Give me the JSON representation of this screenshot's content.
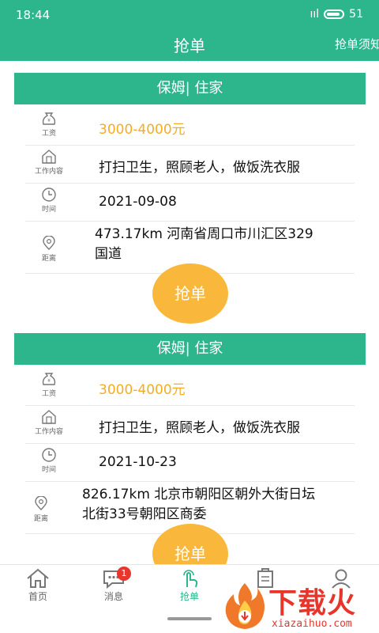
{
  "status_bar": {
    "time": "18:44",
    "signal": "ııl",
    "battery": "51"
  },
  "header": {
    "title": "抢单",
    "right_link": "抢单须知"
  },
  "orders": [
    {
      "category": "保姆| 住家",
      "salary_label": "工资",
      "salary": "3000-4000元",
      "content_label": "工作内容",
      "content": "打扫卫生，照顾老人，做饭洗衣服",
      "time_label": "时间",
      "date": "2021-09-08",
      "distance_label": "距离",
      "distance_line1": "473.17km 河南省周口市川汇区329",
      "distance_line2": "国道",
      "button": "抢单"
    },
    {
      "category": "保姆| 住家",
      "salary_label": "工资",
      "salary": "3000-4000元",
      "content_label": "工作内容",
      "content": "打扫卫生，照顾老人，做饭洗衣服",
      "time_label": "时间",
      "date": "2021-10-23",
      "distance_label": "距离",
      "distance_line1": "826.17km 北京市朝阳区朝外大街日坛",
      "distance_line2": "北街33号朝阳区商委",
      "button": "抢单"
    }
  ],
  "nav": {
    "items": [
      {
        "label": "首页",
        "icon": "home-icon"
      },
      {
        "label": "消息",
        "icon": "message-icon",
        "badge": "1"
      },
      {
        "label": "抢单",
        "icon": "tap-hand-icon"
      },
      {
        "label": "",
        "icon": "clipboard-icon"
      },
      {
        "label": "",
        "icon": "profile-icon"
      }
    ]
  },
  "watermark": {
    "text": "下载火",
    "url": "xiazaihuo.com"
  },
  "colors": {
    "primary": "#2db58c",
    "accent": "#f9b83b",
    "salary": "#f4ac25",
    "badge": "#e8352e"
  }
}
